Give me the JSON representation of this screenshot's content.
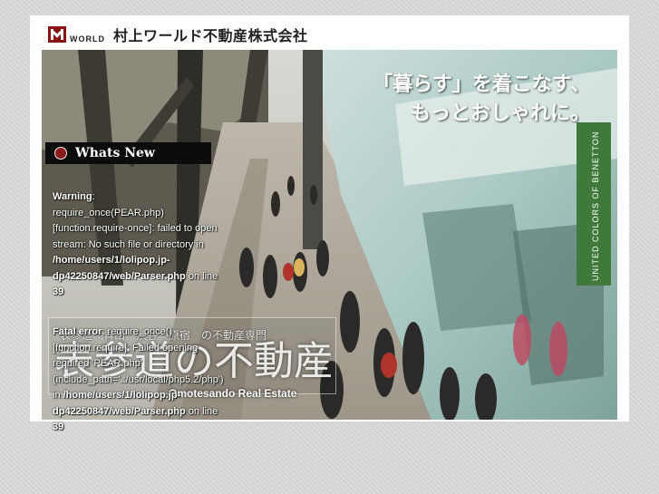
{
  "header": {
    "logo_word": "WORLD",
    "company_name": "村上ワールド不動産株式会社"
  },
  "hero": {
    "tagline_line1": "「暮らす」を着こなす、",
    "tagline_line2": "もっとおしゃれに。",
    "overlay_small": "表参道　青山　渋谷　原宿　の不動産専門",
    "overlay_large": "表参道の不動産",
    "overlay_english": "Omotesando Real Estate",
    "storefront_banner": "UNITED COLORS OF BENETTON"
  },
  "whats_new": {
    "label": "Whats New"
  },
  "errors": [
    {
      "type": "Warning",
      "message": "require_once(PEAR.php) [function.require-once]: failed to open stream: No such file or directory in",
      "path": "/home/users/1/lolipop.jp-dp42250847/web/Parser.php",
      "on": "on",
      "line_label": "line",
      "line": "39"
    },
    {
      "type": "Fatal error",
      "message": "require_once() [function.require]: Failed opening required 'PEAR.php' (include_path='.:/usr/local/php5.2/php') in",
      "path": "/home/users/1/lolipop.jp-dp42250847/web/Parser.php",
      "on": "on",
      "line_label": "line",
      "line": "39"
    }
  ],
  "colors": {
    "brand": "#8a1212",
    "page_bg": "#d4d4d4",
    "panel_bg": "#ffffff",
    "whats_new_bg": "#0c0c0c"
  }
}
